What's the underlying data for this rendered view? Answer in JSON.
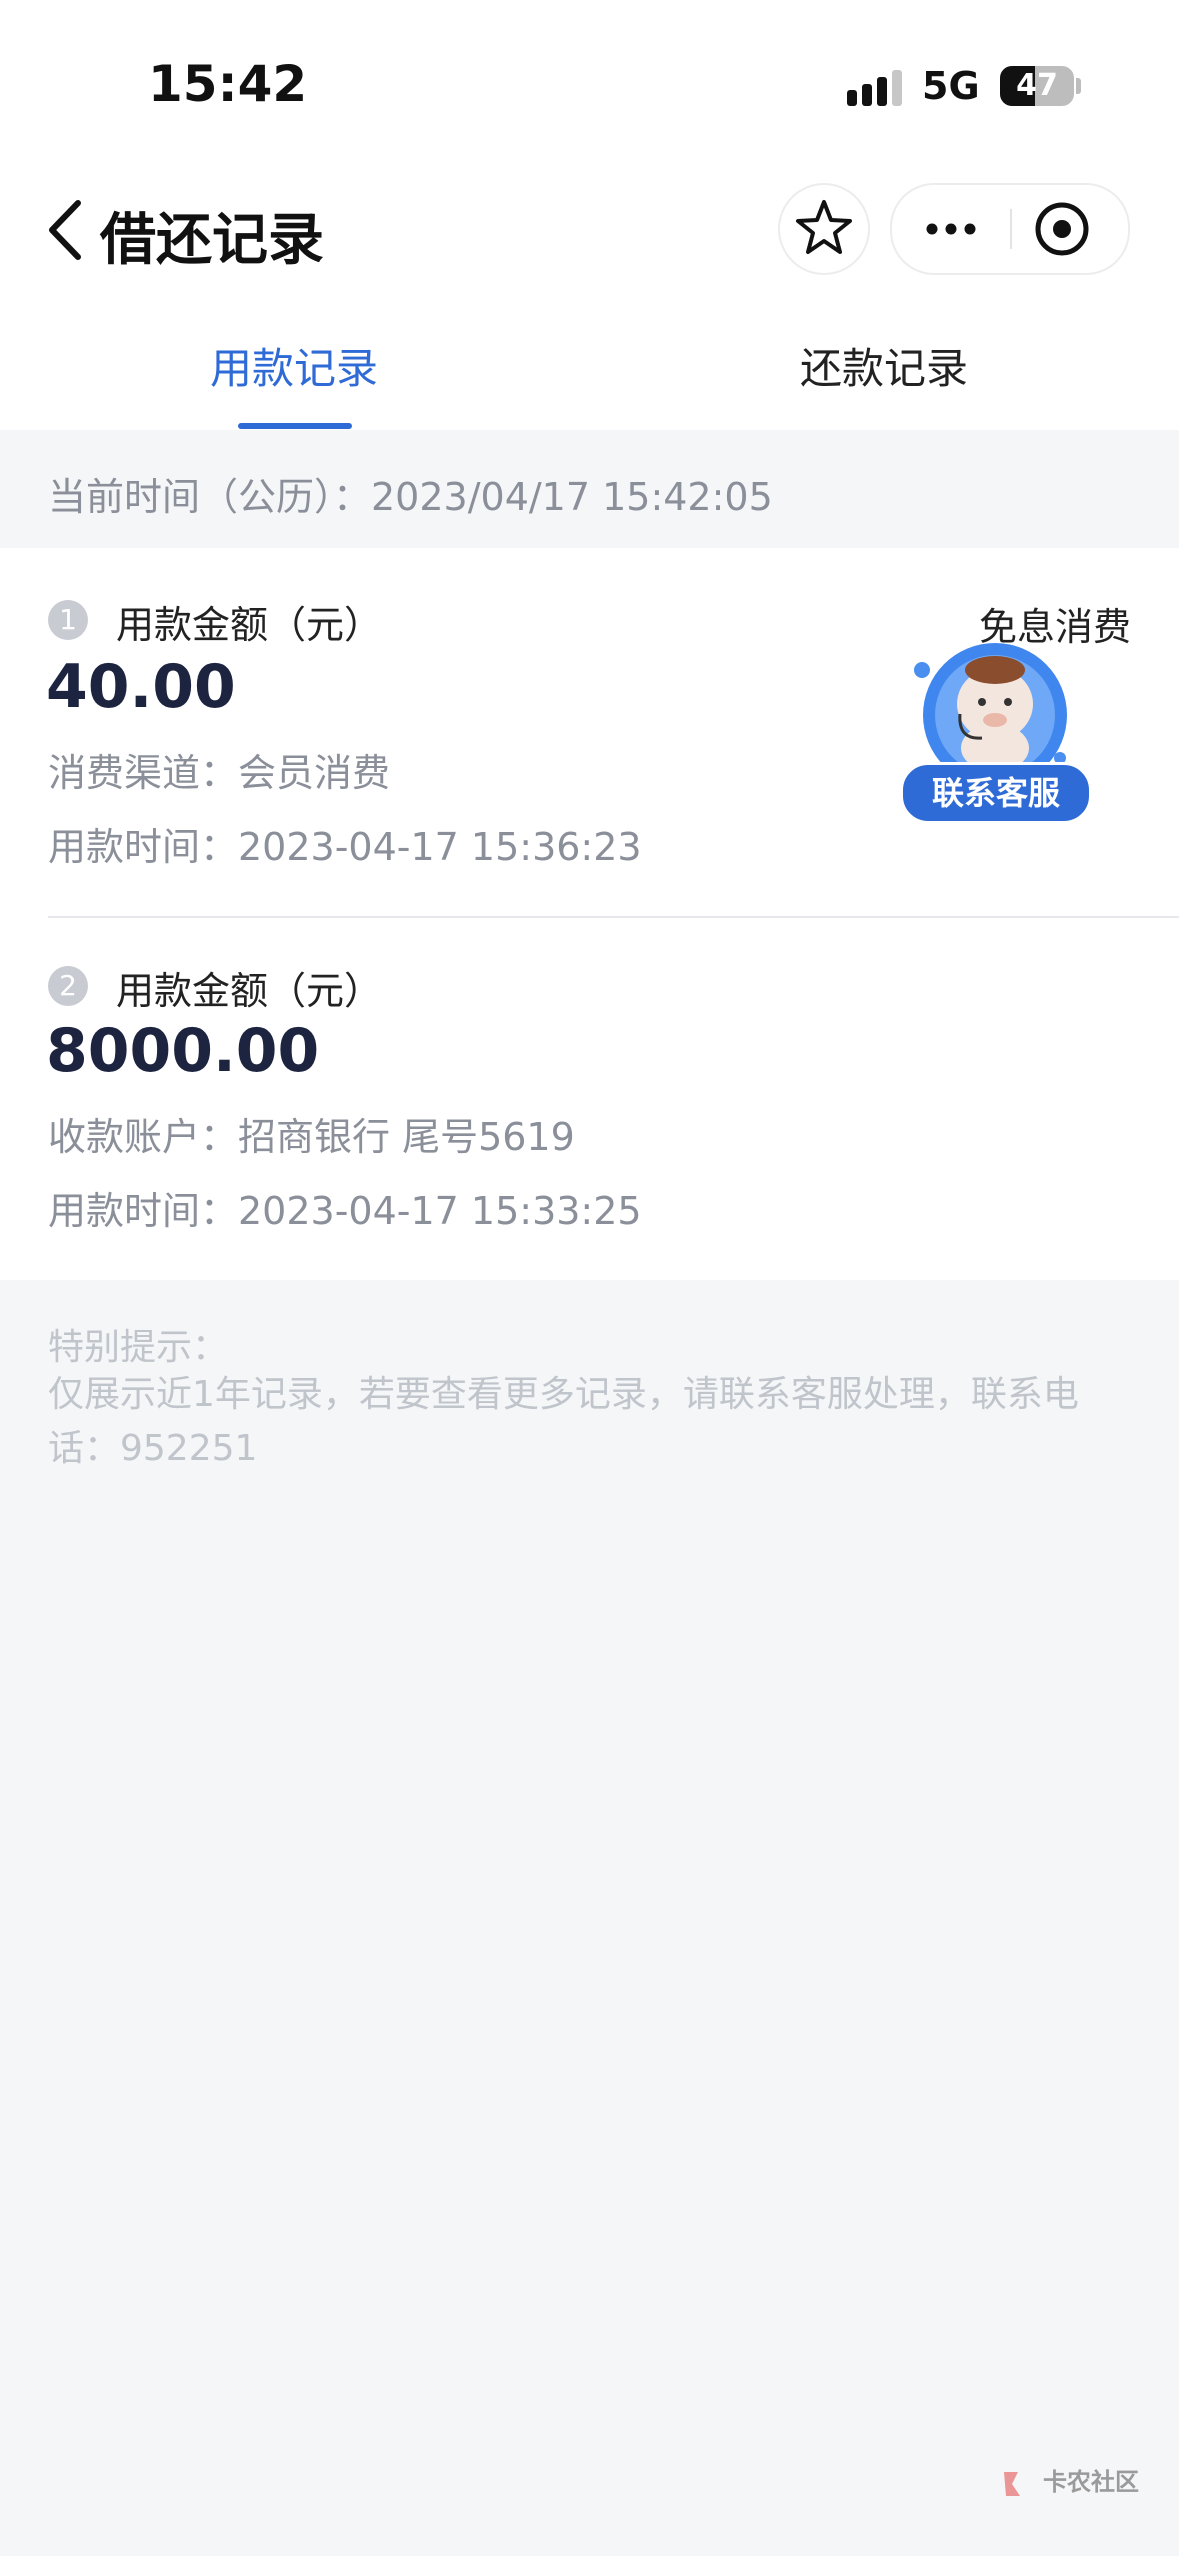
{
  "status_bar": {
    "time": "15:42",
    "network": "5G",
    "battery": "47",
    "battery_level": 0.47
  },
  "nav": {
    "title": "借还记录"
  },
  "tabs": [
    {
      "label": "用款记录",
      "active": true
    },
    {
      "label": "还款记录",
      "active": false
    }
  ],
  "current_time": "当前时间（公历）：2023/04/17 15:42:05",
  "records": [
    {
      "index": "1",
      "amount_label": "用款金额（元）",
      "amount": "40.00",
      "tag": "免息消费",
      "line1": "消费渠道：会员消费",
      "line2": "用款时间：2023-04-17 15:36:23"
    },
    {
      "index": "2",
      "amount_label": "用款金额（元）",
      "amount": "8000.00",
      "line1": "收款账户：招商银行 尾号5619",
      "line2": "用款时间：2023-04-17 15:33:25"
    }
  ],
  "customer_service": {
    "label": "联系客服"
  },
  "notice": {
    "title": "特别提示：",
    "body": "仅展示近1年记录，若要查看更多记录，请联系客服处理，联系电话：952251"
  },
  "watermark": "卡农社区",
  "colors": {
    "accent": "#2f6bd6",
    "page_bg": "#f5f6f8",
    "badge_dot": "#e8452f"
  }
}
